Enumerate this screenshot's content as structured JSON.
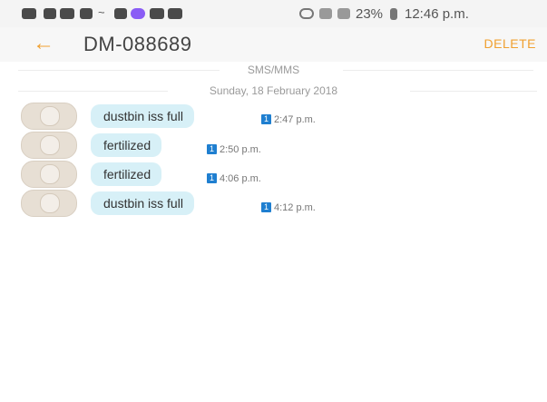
{
  "status_bar": {
    "battery_text": "23%",
    "time": "12:46 p.m."
  },
  "app_bar": {
    "back_icon": "arrow-left-icon",
    "title": "DM-088689",
    "delete_label": "DELETE"
  },
  "conversation": {
    "channel_label": "SMS/MMS",
    "date_label": "Sunday, 18 February 2018",
    "messages": [
      {
        "text": "dustbin iss full",
        "sim": "1",
        "time": "2:47 p.m."
      },
      {
        "text": "fertilized",
        "sim": "1",
        "time": "2:50 p.m."
      },
      {
        "text": "fertilized",
        "sim": "1",
        "time": "4:06 p.m."
      },
      {
        "text": "dustbin iss full",
        "sim": "1",
        "time": "4:12 p.m."
      }
    ]
  },
  "colors": {
    "accent": "#f0a030",
    "bubble": "#d7f0f7",
    "sim_badge": "#1f7fd0"
  }
}
